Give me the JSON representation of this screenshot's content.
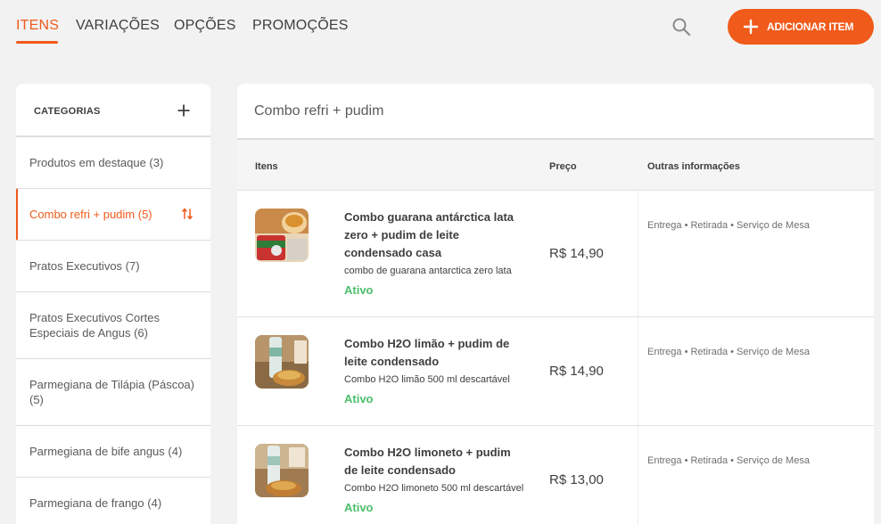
{
  "nav": {
    "tabs": [
      {
        "label": "ITENS",
        "active": true
      },
      {
        "label": "VARIAÇÕES",
        "active": false
      },
      {
        "label": "OPÇÕES",
        "active": false
      },
      {
        "label": "PROMOÇÕES",
        "active": false
      }
    ],
    "add_button_label": "ADICIONAR ITEM"
  },
  "sidebar": {
    "title": "CATEGORIAS",
    "items": [
      {
        "label": "Produtos em destaque (3)"
      },
      {
        "label": "Combo refri + pudim (5)",
        "active": true
      },
      {
        "label": "Pratos Executivos (7)"
      },
      {
        "label": "Pratos Executivos Cortes Especiais de Angus (6)"
      },
      {
        "label": "Parmegiana de Tilápia (Páscoa) (5)"
      },
      {
        "label": "Parmegiana de bife angus (4)"
      },
      {
        "label": "Parmegiana de frango (4)"
      }
    ]
  },
  "main": {
    "title": "Combo refri + pudim",
    "columns": {
      "items": "Itens",
      "price": "Preço",
      "other": "Outras informações"
    },
    "rows": [
      {
        "name": "Combo guarana antárctica lata zero + pudim de leite condensado casa",
        "description": "combo de guarana antarctica zero lata",
        "status": "Ativo",
        "price": "R$ 14,90",
        "other": "Entrega • Retirada • Serviço de Mesa"
      },
      {
        "name": "Combo H2O limão + pudim de leite condensado",
        "description": "Combo H2O limão 500 ml descartável",
        "status": "Ativo",
        "price": "R$ 14,90",
        "other": "Entrega • Retirada • Serviço de Mesa"
      },
      {
        "name": "Combo H2O limoneto + pudim de leite condensado",
        "description": "Combo H2O limoneto 500 ml descartável",
        "status": "Ativo",
        "price": "R$ 13,00",
        "other": "Entrega • Retirada • Serviço de Mesa"
      }
    ]
  },
  "colors": {
    "accent": "#f05a1a",
    "status_active": "#4bbf6b"
  }
}
